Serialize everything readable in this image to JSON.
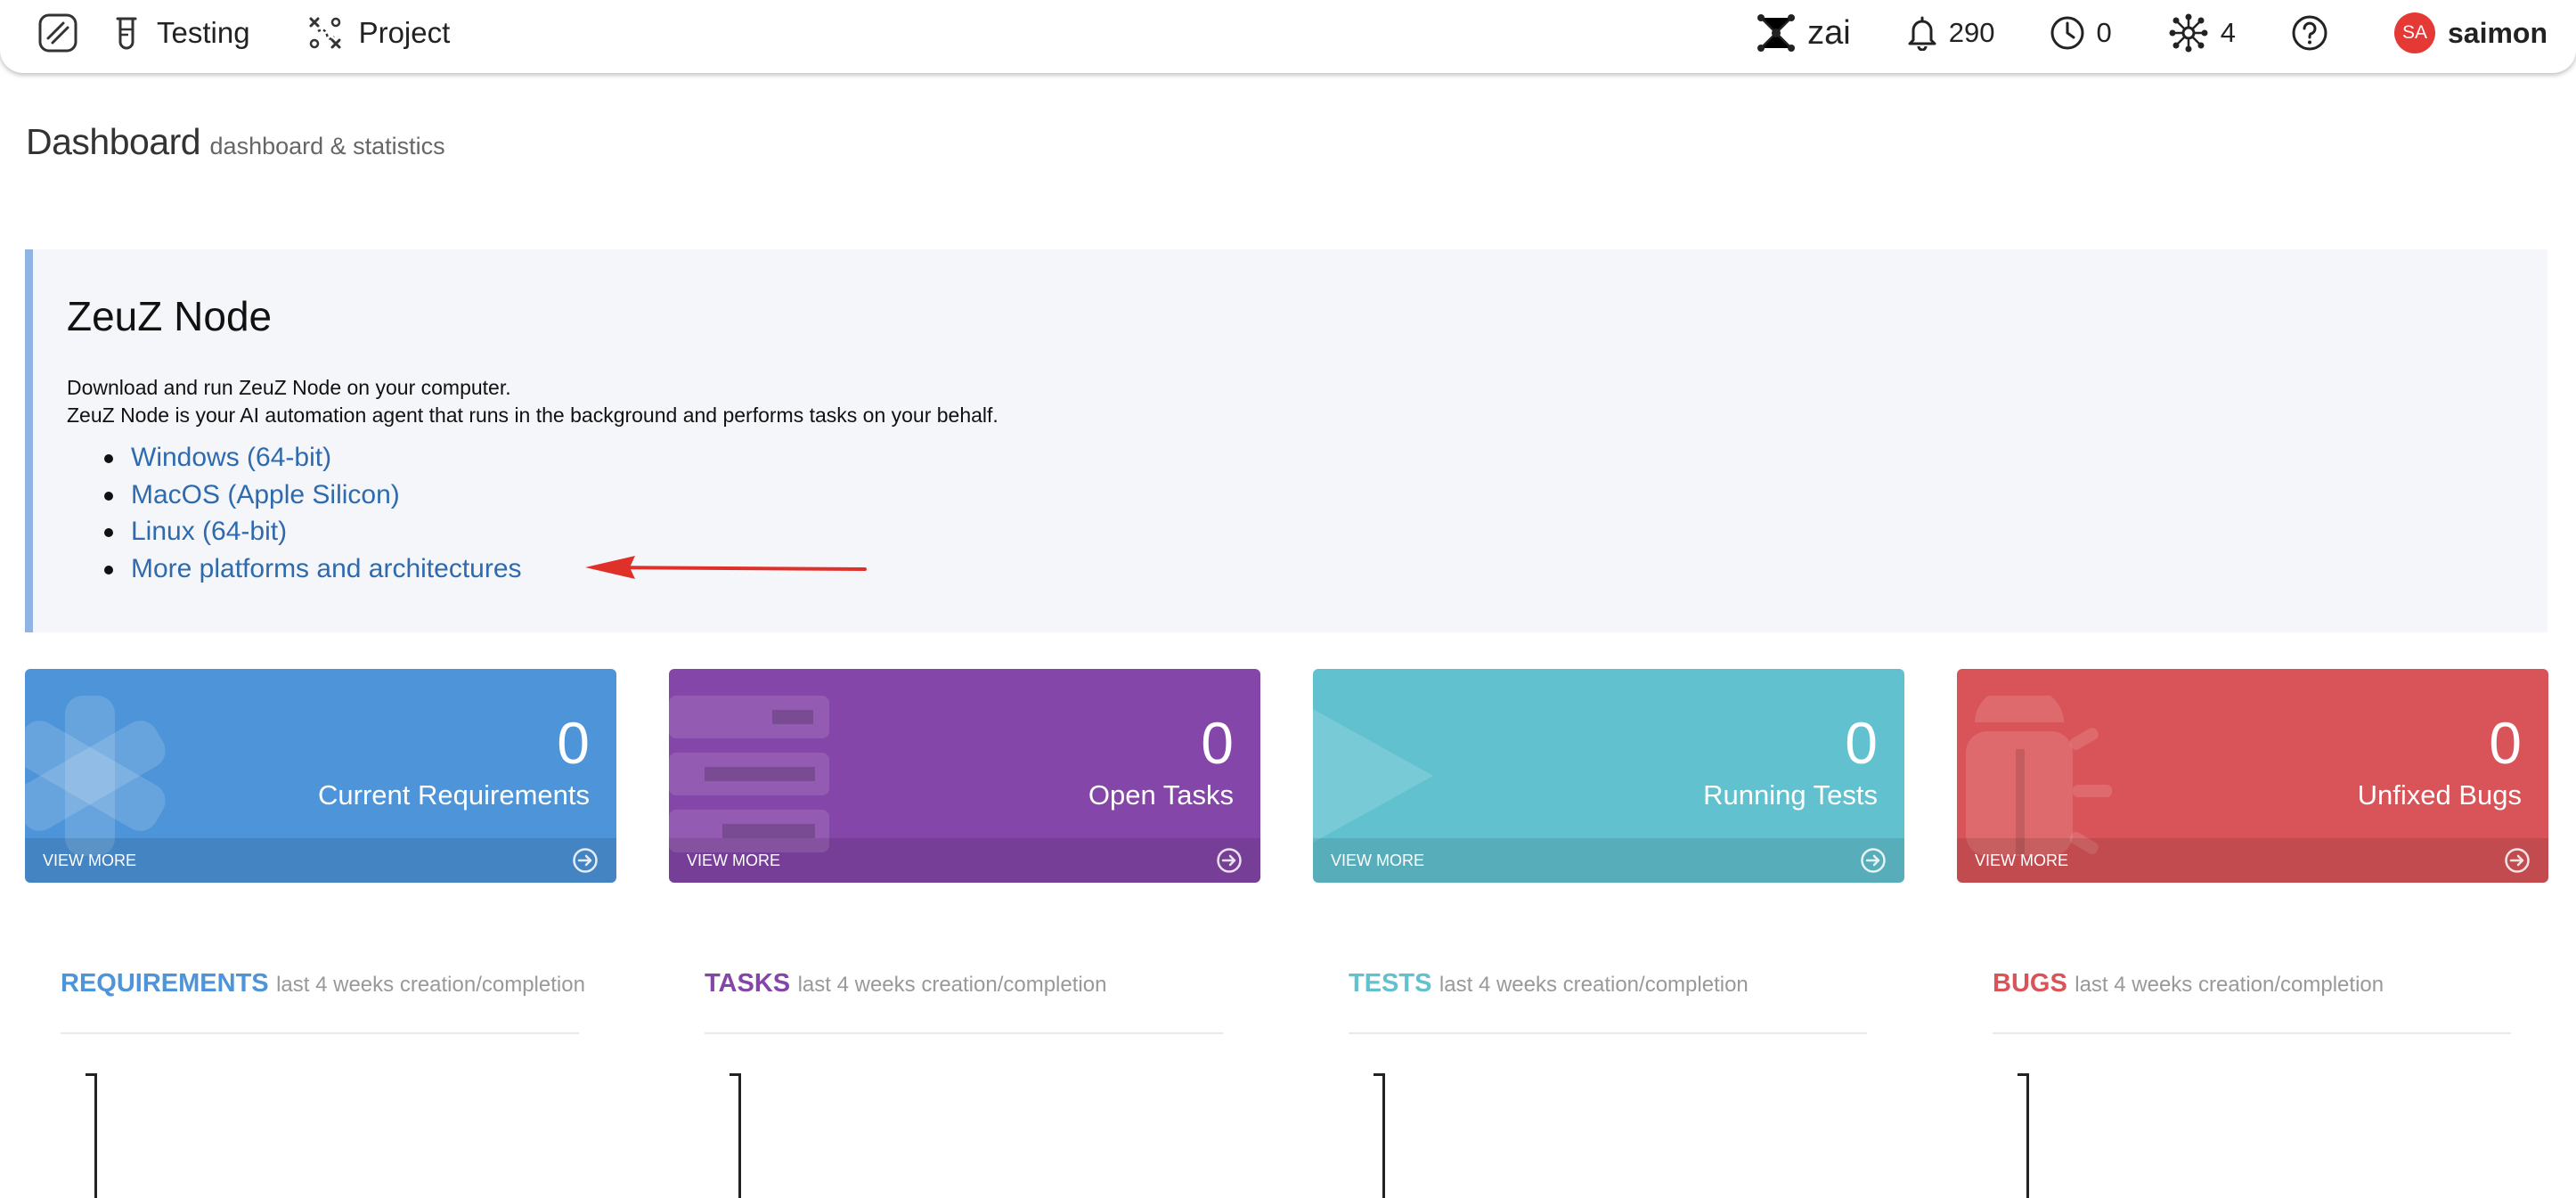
{
  "nav": {
    "testing_label": "Testing",
    "project_label": "Project",
    "zai_label": "zai",
    "notifications_count": "290",
    "history_count": "0",
    "nodes_count": "4",
    "avatar_initials": "SA",
    "username": "saimon"
  },
  "page": {
    "title": "Dashboard",
    "subtitle": "dashboard & statistics"
  },
  "node_panel": {
    "title": "ZeuZ Node",
    "description_line1": "Download and run ZeuZ Node on your computer.",
    "description_line2": "ZeuZ Node is your AI automation agent that runs in the background and performs tasks on your behalf.",
    "links": [
      "Windows (64-bit)",
      "MacOS (Apple Silicon)",
      "Linux (64-bit)",
      "More platforms and architectures"
    ]
  },
  "cards": [
    {
      "count": "0",
      "label": "Current Requirements",
      "footer": "VIEW MORE",
      "color": "#4d94d8"
    },
    {
      "count": "0",
      "label": "Open Tasks",
      "footer": "VIEW MORE",
      "color": "#8446a8"
    },
    {
      "count": "0",
      "label": "Running Tests",
      "footer": "VIEW MORE",
      "color": "#61c1cf"
    },
    {
      "count": "0",
      "label": "Unfixed Bugs",
      "footer": "VIEW MORE",
      "color": "#d95458"
    }
  ],
  "charts": [
    {
      "name": "REQUIREMENTS",
      "subtitle": "last 4 weeks creation/completion",
      "color": "#4d94d8"
    },
    {
      "name": "TASKS",
      "subtitle": "last 4 weeks creation/completion",
      "color": "#8446a8"
    },
    {
      "name": "TESTS",
      "subtitle": "last 4 weeks creation/completion",
      "color": "#61c1cf"
    },
    {
      "name": "BUGS",
      "subtitle": "last 4 weeks creation/completion",
      "color": "#d95458"
    }
  ],
  "colors": {
    "link": "#2e6aad",
    "panel_bg": "#f4f6fa",
    "panel_accent": "#8fb3e3",
    "annotation_arrow": "#e0302a"
  }
}
